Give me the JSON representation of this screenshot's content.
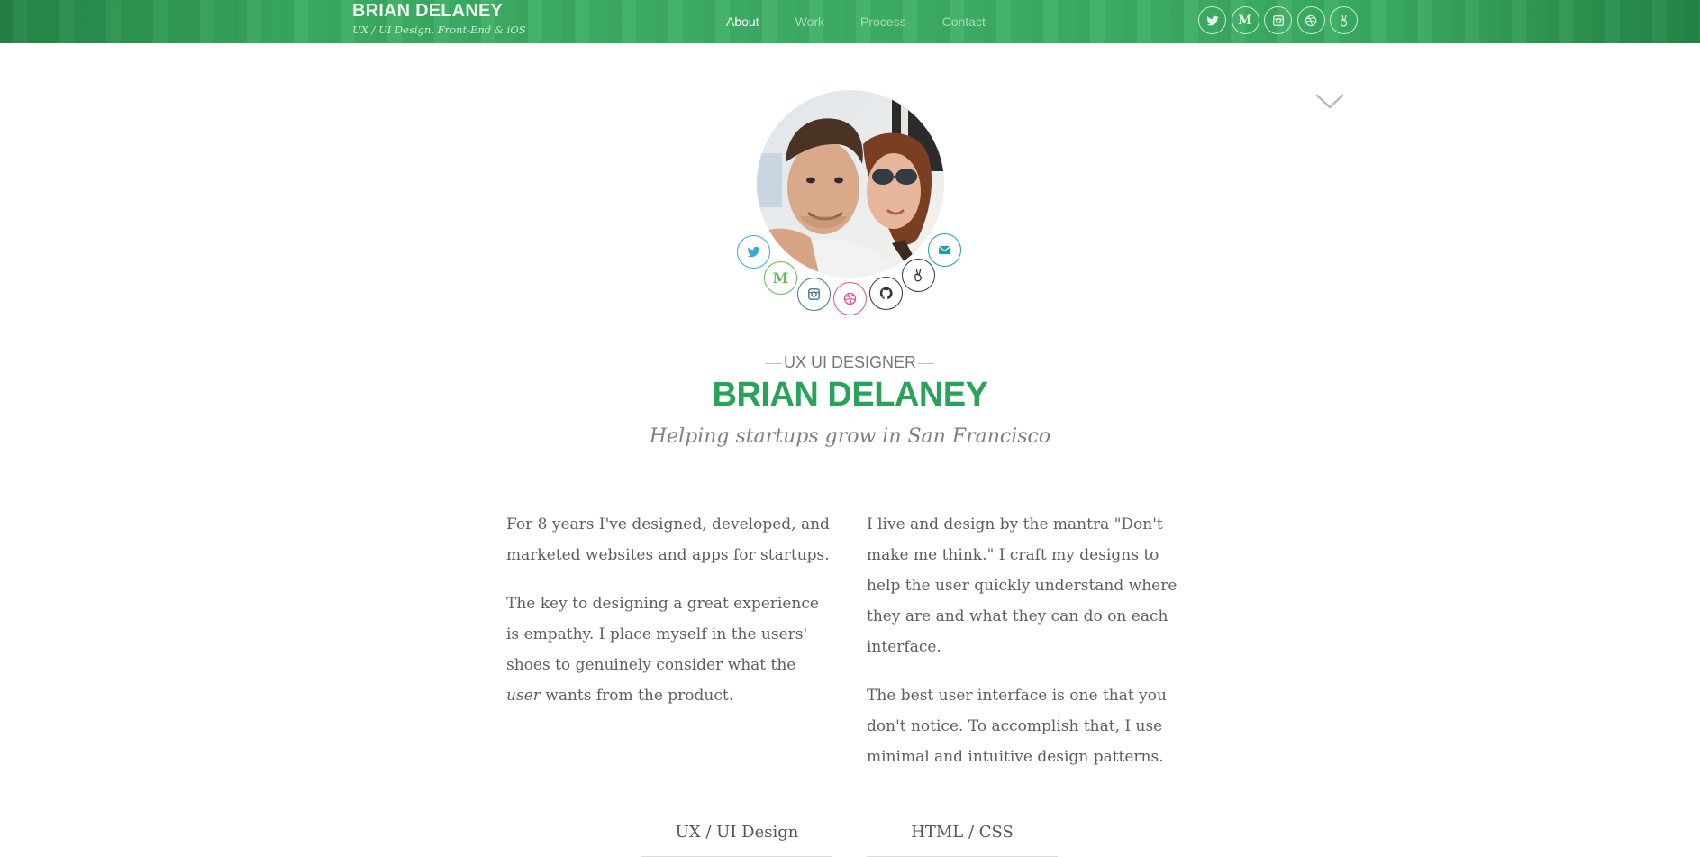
{
  "header": {
    "brand_name": "BRIAN DELANEY",
    "brand_tagline": "UX / UI Design, Front-End & iOS",
    "nav": [
      {
        "label": "About",
        "active": true
      },
      {
        "label": "Work",
        "active": false
      },
      {
        "label": "Process",
        "active": false
      },
      {
        "label": "Contact",
        "active": false
      }
    ],
    "social_icons": [
      "twitter-icon",
      "medium-icon",
      "instagram-icon",
      "dribbble-icon",
      "angellist-icon"
    ],
    "medium_letter": "M",
    "bar_color": "#3fb067"
  },
  "profile": {
    "ring_icons": [
      {
        "name": "twitter-icon",
        "color": "#3aa8d8"
      },
      {
        "name": "medium-icon",
        "color": "#5cb85c"
      },
      {
        "name": "instagram-icon",
        "color": "#3f729b"
      },
      {
        "name": "dribbble-icon",
        "color": "#ea4c89"
      },
      {
        "name": "github-icon",
        "color": "#333333"
      },
      {
        "name": "angellist-icon",
        "color": "#333333"
      },
      {
        "name": "email-icon",
        "color": "#1aa3a3"
      }
    ],
    "medium_letter": "M"
  },
  "hero": {
    "role": "UX UI DESIGNER",
    "name": "BRIAN DELANEY",
    "tagline": "Helping startups grow in San Francisco",
    "accent_color": "#2aa35a"
  },
  "about": {
    "left": {
      "p1": "For 8 years I've designed, developed, and marketed websites and apps for startups.",
      "p2_before": "The key to designing a great experience is empathy. I place myself in the users' shoes to genuinely consider what the ",
      "p2_emphasis": "user",
      "p2_after": " wants from the product."
    },
    "right": {
      "p1": "I live and design by the mantra \"Don't make me think.\" I craft my designs to help the user quickly understand where they are and what they can do on each interface.",
      "p2": "The best user interface is one that you don't notice. To accomplish that, I use minimal and intuitive design patterns."
    }
  },
  "skills": [
    {
      "label": "UX / UI Design"
    },
    {
      "label": "HTML / CSS"
    }
  ]
}
